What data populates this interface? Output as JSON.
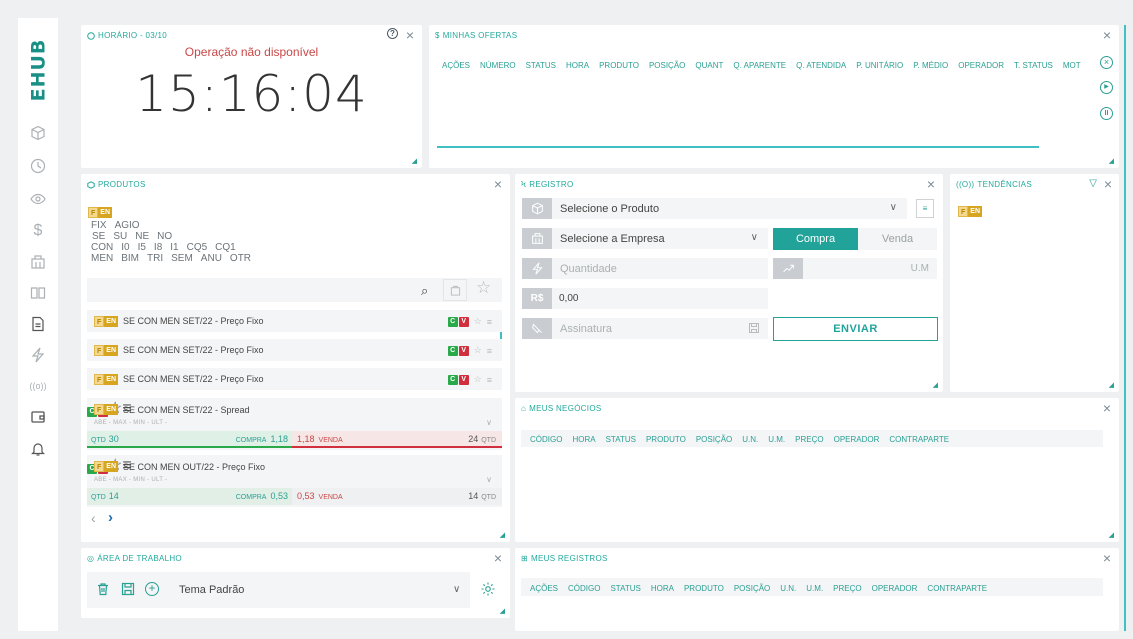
{
  "sidebar": {
    "logo": "EHUB",
    "icons": [
      "cube-icon",
      "clock-icon",
      "eye-icon",
      "dollar-icon",
      "building-icon",
      "book-icon",
      "document-icon",
      "lightning-icon",
      "broadcast-icon",
      "wallet-icon",
      "bell-icon"
    ]
  },
  "horario": {
    "title": "HORÁRIO - 03/10",
    "status": "Operação não disponível",
    "time": "15:16:04"
  },
  "ofertas": {
    "title": "MINHAS OFERTAS",
    "columns": [
      "AÇÕES",
      "NÚMERO",
      "STATUS",
      "HORA",
      "PRODUTO",
      "POSIÇÃO",
      "QUANT",
      "Q. APARENTE",
      "Q. ATENDIDA",
      "P. UNITÁRIO",
      "P. MÉDIO",
      "OPERADOR",
      "T. STATUS",
      "MOT"
    ]
  },
  "produtos": {
    "title": "PRODUTOS",
    "chip_f": "F",
    "chip_en": "EN",
    "filter_rows": [
      [
        "FIX",
        "AGIO"
      ],
      [
        "SE",
        "SU",
        "NE",
        "NO"
      ],
      [
        "CON",
        "I0",
        "I5",
        "I8",
        "I1",
        "CQ5",
        "CQ1"
      ],
      [
        "MEN",
        "BIM",
        "TRI",
        "SEM",
        "ANU",
        "OTR"
      ]
    ],
    "items": [
      {
        "name": "SE CON MEN SET/22 - Preço Fixo"
      },
      {
        "name": "SE CON MEN SET/22 - Preço Fixo"
      },
      {
        "name": "SE CON MEN SET/22 - Preço Fixo"
      }
    ],
    "detail": [
      {
        "name": "SE CON MEN SET/22 - Spread",
        "sub": "ABE -  MAX -  MIN -  ULT -",
        "qtd_label": "QTD",
        "qtd": "30",
        "compra_label": "COMPRA",
        "compra": "1,18",
        "venda": "1,18",
        "venda_label": "VENDA",
        "qtd_right": "24",
        "qtd_right_label": "QTD"
      },
      {
        "name": "SE CON MEN OUT/22 - Preço Fixo",
        "sub": "ABE -  MAX -  MIN -  ULT -",
        "qtd_label": "QTD",
        "qtd": "14",
        "compra_label": "COMPRA",
        "compra": "0,53",
        "venda": "0,53",
        "venda_label": "VENDA",
        "qtd_right": "14",
        "qtd_right_label": "QTD"
      }
    ],
    "cv_c": "C",
    "cv_v": "V"
  },
  "registro": {
    "title": "REGISTRO",
    "produto_placeholder": "Selecione o Produto",
    "empresa_placeholder": "Selecione a Empresa",
    "compra": "Compra",
    "venda": "Venda",
    "quantidade": "Quantidade",
    "um": "U.M",
    "currency": "R$",
    "valor": "0,00",
    "assinatura": "Assinatura",
    "enviar": "ENVIAR"
  },
  "tendencias": {
    "title": "TENDÊNCIAS",
    "chip_f": "F",
    "chip_en": "EN"
  },
  "negocios": {
    "title": "MEUS NEGÓCIOS",
    "columns": [
      "CÓDIGO",
      "HORA",
      "STATUS",
      "PRODUTO",
      "POSIÇÃO",
      "U.N.",
      "U.M.",
      "PREÇO",
      "OPERADOR",
      "CONTRAPARTE"
    ]
  },
  "area": {
    "title": "ÁREA DE TRABALHO",
    "tema": "Tema Padrão"
  },
  "registros": {
    "title": "MEUS REGISTROS",
    "columns": [
      "AÇÕES",
      "CÓDIGO",
      "STATUS",
      "HORA",
      "PRODUTO",
      "POSIÇÃO",
      "U.N.",
      "U.M.",
      "PREÇO",
      "OPERADOR",
      "CONTRAPARTE"
    ]
  },
  "colors": {
    "accent": "#22aa9c",
    "buy": "#2aa94a",
    "sell": "#d02f3e",
    "status_red": "#c94747"
  }
}
